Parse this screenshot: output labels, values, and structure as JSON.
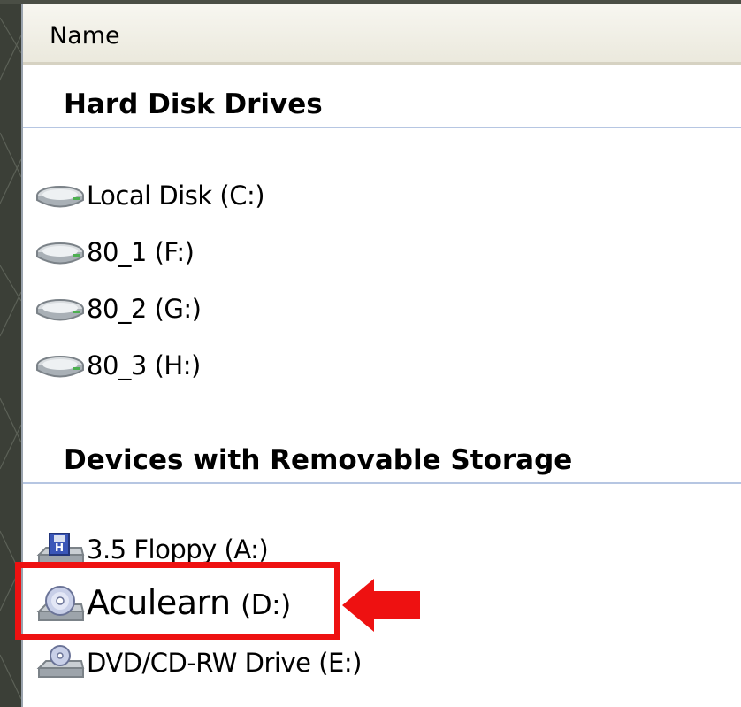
{
  "header": {
    "name_label": "Name"
  },
  "groups": [
    {
      "title": "Hard Disk Drives",
      "items": [
        {
          "label": "Local Disk (C:)",
          "icon": "hard-disk-icon"
        },
        {
          "label": "80_1 (F:)",
          "icon": "hard-disk-icon"
        },
        {
          "label": "80_2 (G:)",
          "icon": "hard-disk-icon"
        },
        {
          "label": "80_3 (H:)",
          "icon": "hard-disk-icon"
        }
      ]
    },
    {
      "title": "Devices with Removable Storage",
      "items": [
        {
          "label": "3.5 Floppy (A:)",
          "icon": "floppy-drive-icon"
        },
        {
          "label": "Aculearn",
          "suffix": "(D:)",
          "icon": "cd-drive-icon",
          "highlighted": true
        },
        {
          "label": "DVD/CD-RW Drive (E:)",
          "icon": "dvd-drive-icon"
        }
      ]
    }
  ],
  "annotation": {
    "highlight_color": "#ee1111",
    "arrow_color": "#ee1111"
  }
}
